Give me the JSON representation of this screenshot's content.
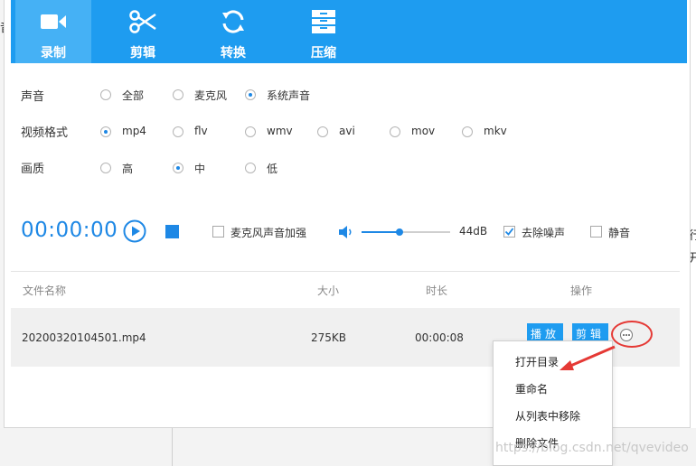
{
  "toolbar": {
    "tabs": [
      {
        "label": "录制",
        "icon": "video-camera-icon"
      },
      {
        "label": "剪辑",
        "icon": "scissors-icon"
      },
      {
        "label": "转换",
        "icon": "refresh-icon"
      },
      {
        "label": "压缩",
        "icon": "archive-icon"
      }
    ],
    "active": "录制"
  },
  "settings": {
    "audio": {
      "label": "声音",
      "options": [
        "全部",
        "麦克风",
        "系统声音"
      ],
      "selected": "系统声音"
    },
    "format": {
      "label": "视频格式",
      "options": [
        "mp4",
        "flv",
        "wmv",
        "avi",
        "mov",
        "mkv"
      ],
      "selected": "mp4"
    },
    "quality": {
      "label": "画质",
      "options": [
        "高",
        "中",
        "低"
      ],
      "selected": "中"
    }
  },
  "controls": {
    "timer": "00:00:00",
    "mic_boost_label": "麦克风声音加强",
    "mic_boost_checked": false,
    "volume_fraction": 0.43,
    "volume_label": "44dB",
    "denoise_label": "去除噪声",
    "denoise_checked": true,
    "mute_label": "静音",
    "mute_checked": false
  },
  "file_table": {
    "headers": {
      "name": "文件名称",
      "size": "大小",
      "duration": "时长",
      "ops": "操作"
    },
    "rows": [
      {
        "name": "20200320104501.mp4",
        "size": "275KB",
        "duration": "00:00:08"
      }
    ],
    "buttons": {
      "play": "播放",
      "edit": "剪辑"
    }
  },
  "context_menu": {
    "items": [
      "打开目录",
      "重命名",
      "从列表中移除",
      "删除文件"
    ]
  },
  "background_fragments": [
    "音",
    "行",
    "开"
  ],
  "watermark": "https://blog.csdn.net/qvevideo",
  "colors": {
    "accent": "#1e9cf0",
    "annotation": "#e53935"
  }
}
